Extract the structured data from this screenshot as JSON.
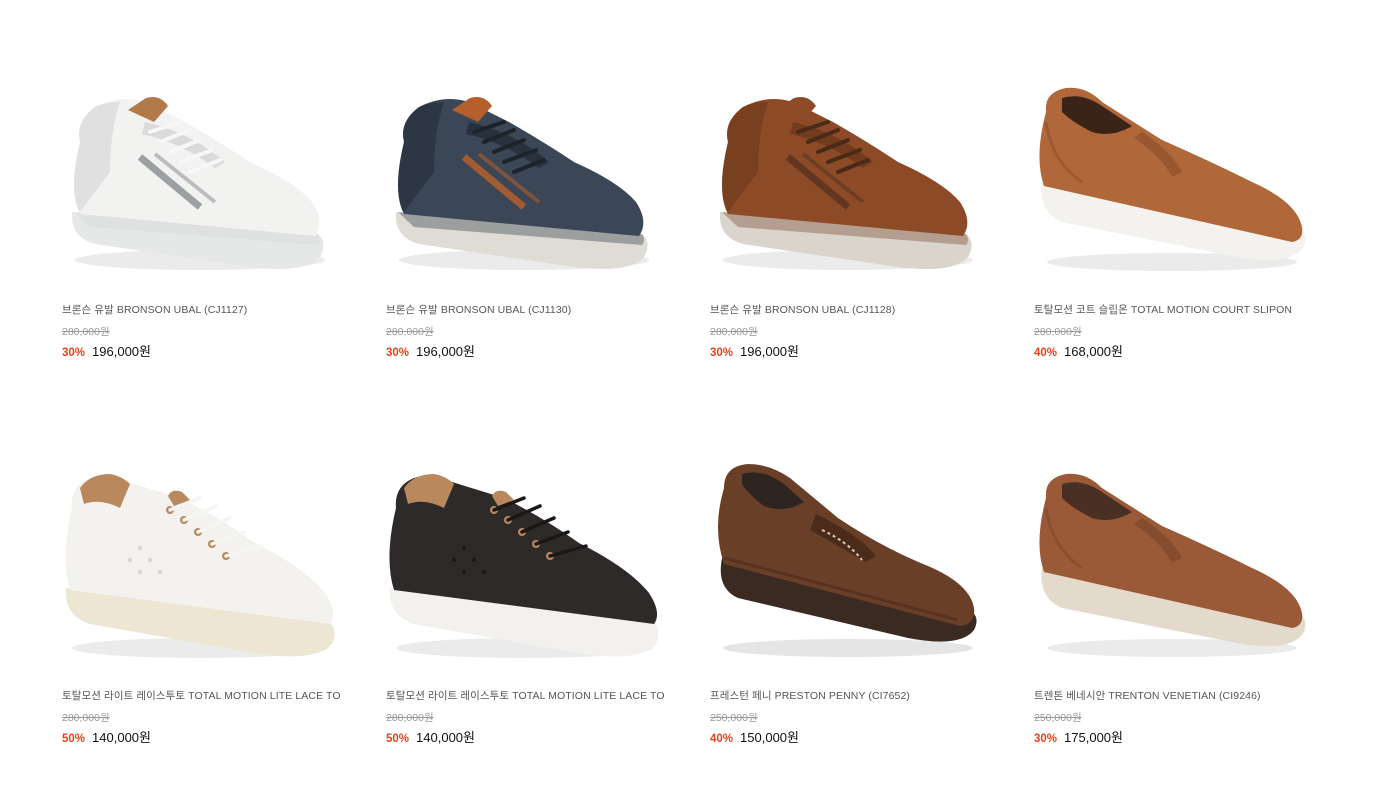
{
  "products": [
    {
      "name": "브론슨 유발 BRONSON UBAL (CJ1127)",
      "original_price": "280,000원",
      "discount": "30%",
      "price": "196,000원",
      "image": "white-leather-sneaker",
      "colors": {
        "upper": "#f2f2f1",
        "shade": "#d2d3d3",
        "sole": "#e6e7e7",
        "accent": "#8e9296",
        "tab": "#b27a48",
        "lace": "#f7f7f7"
      }
    },
    {
      "name": "브론슨 유발 BRONSON UBAL (CJ1130)",
      "original_price": "280,000원",
      "discount": "30%",
      "price": "196,000원",
      "image": "navy-leather-sneaker",
      "colors": {
        "upper": "#3b4656",
        "shade": "#242d39",
        "sole": "#dedcd4",
        "accent": "#b5602b",
        "tab": "#b5602b",
        "lace": "#1d232b"
      }
    },
    {
      "name": "브론슨 유발 BRONSON UBAL (CJ1128)",
      "original_price": "280,000원",
      "discount": "30%",
      "price": "196,000원",
      "image": "brown-leather-sneaker",
      "colors": {
        "upper": "#8c4b26",
        "shade": "#6c381c",
        "sole": "#d9d4cc",
        "accent": "#5a3422",
        "tab": "#8c4b26",
        "lace": "#4a2a18"
      }
    },
    {
      "name": "토탈모션 코트 슬립온 TOTAL MOTION COURT SLIPON",
      "original_price": "280,000원",
      "discount": "40%",
      "price": "168,000원",
      "image": "tan-slip-on",
      "colors": {
        "upper": "#b0673a",
        "shade": "#8a4c28",
        "sole": "#f4f2ee",
        "accent": "#3a2418",
        "tab": "#b0673a",
        "lace": "#b0673a"
      }
    },
    {
      "name": "토탈모션 라이트 레이스투토 TOTAL MOTION LITE LACE TO",
      "original_price": "280,000원",
      "discount": "50%",
      "price": "140,000원",
      "image": "white-lace-to-toe",
      "colors": {
        "upper": "#f3f2ef",
        "shade": "#d8d6d1",
        "sole": "#ece6d3",
        "accent": "#b9885c",
        "tab": "#b9885c",
        "lace": "#f5f5f3"
      }
    },
    {
      "name": "토탈모션 라이트 레이스투토 TOTAL MOTION LITE LACE TO",
      "original_price": "280,000원",
      "discount": "50%",
      "price": "140,000원",
      "image": "black-lace-to-toe",
      "colors": {
        "upper": "#2e2a29",
        "shade": "#1b1918",
        "sole": "#f2f1ee",
        "accent": "#b9885c",
        "tab": "#b9885c",
        "lace": "#1a1817"
      }
    },
    {
      "name": "프레스턴 페니 PRESTON PENNY (CI7652)",
      "original_price": "250,000원",
      "discount": "40%",
      "price": "150,000원",
      "image": "brown-penny-loafer",
      "colors": {
        "upper": "#6a3f28",
        "shade": "#4b2b1a",
        "sole": "#3a2a22",
        "accent": "#2f2520",
        "tab": "#6a3f28",
        "lace": "#6a3f28"
      }
    },
    {
      "name": "트렌톤 베네시안 TRENTON VENETIAN (CI9246)",
      "original_price": "250,000원",
      "discount": "30%",
      "price": "175,000원",
      "image": "brown-venetian-loafer",
      "colors": {
        "upper": "#9a5a38",
        "shade": "#7a4228",
        "sole": "#e4dacb",
        "accent": "#4a3024",
        "tab": "#9a5a38",
        "lace": "#9a5a38"
      }
    }
  ]
}
